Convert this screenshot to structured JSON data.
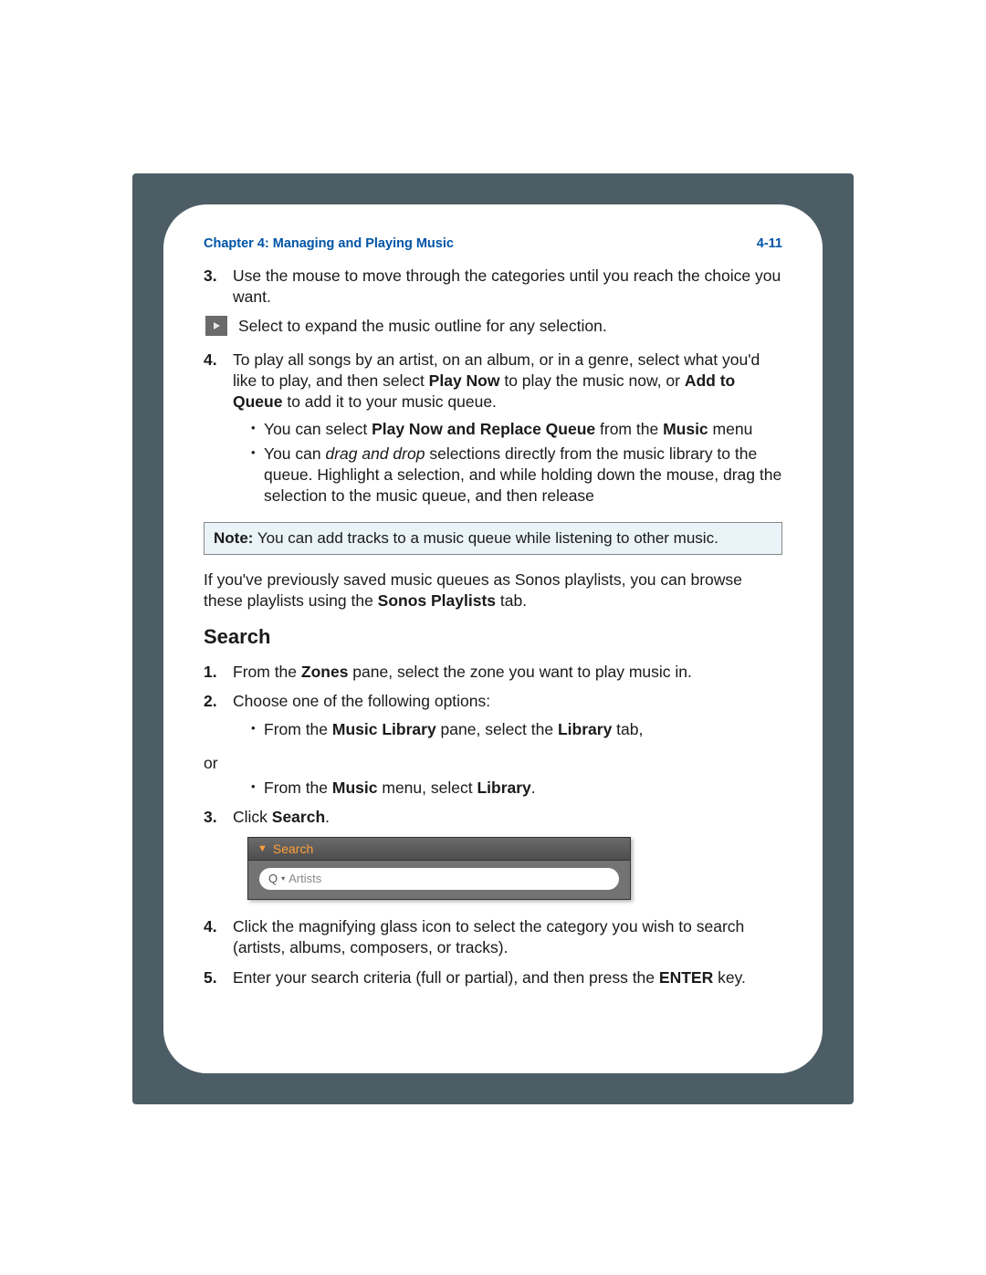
{
  "header": {
    "chapter": "Chapter 4:  Managing and Playing Music",
    "pageNum": "4-11"
  },
  "step3": {
    "num": "3.",
    "text": "Use the mouse to move through the categories until you reach the choice you want."
  },
  "expandHint": "Select to expand the music outline for any selection.",
  "step4": {
    "num": "4.",
    "intro_a": "To play all songs by an artist, on an album, or in a genre, select what you'd like to play, and then select ",
    "playNow": "Play Now",
    "intro_b": " to play the music now, or ",
    "addQueue": "Add to Queue",
    "intro_c": " to add it to your music queue.",
    "b1_a": "You can select ",
    "b1_bold": "Play Now and Replace Queue",
    "b1_b": " from the ",
    "b1_bold2": "Music",
    "b1_c": " menu",
    "b2_a": "You can ",
    "b2_em": "drag and drop",
    "b2_b": " selections directly from the music library to the queue. Highlight a selection, and while holding down the mouse, drag the selection to the music queue, and then release"
  },
  "note": {
    "label": "Note:",
    "text": "  You can add tracks to a music queue while listening to other music."
  },
  "para": {
    "a": "If you've previously saved music queues as Sonos playlists, you can browse these playlists using the ",
    "bold": "Sonos Playlists",
    "b": " tab."
  },
  "searchHeading": "Search",
  "s1": {
    "num": "1.",
    "a": "From the ",
    "b1": "Zones",
    "b": " pane, select the zone you want to play music in."
  },
  "s2": {
    "num": "2.",
    "text": "Choose one of the following options:",
    "opt1_a": "From the ",
    "opt1_b1": "Music Library",
    "opt1_b": " pane, select the ",
    "opt1_b2": "Library",
    "opt1_c": " tab,",
    "or": "or",
    "opt2_a": "From the ",
    "opt2_b1": "Music",
    "opt2_b": " menu, select ",
    "opt2_b2": "Library",
    "opt2_c": "."
  },
  "s3": {
    "num": "3.",
    "a": "Click ",
    "b": "Search",
    "c": "."
  },
  "widget": {
    "title": "Search",
    "placeholder": "Artists"
  },
  "s4": {
    "num": "4.",
    "text": "Click the magnifying glass icon to select the category you wish to search (artists, albums, composers, or tracks)."
  },
  "s5": {
    "num": "5.",
    "a": "Enter your search criteria (full or partial), and then press the ",
    "b": "ENTER",
    "c": " key."
  }
}
